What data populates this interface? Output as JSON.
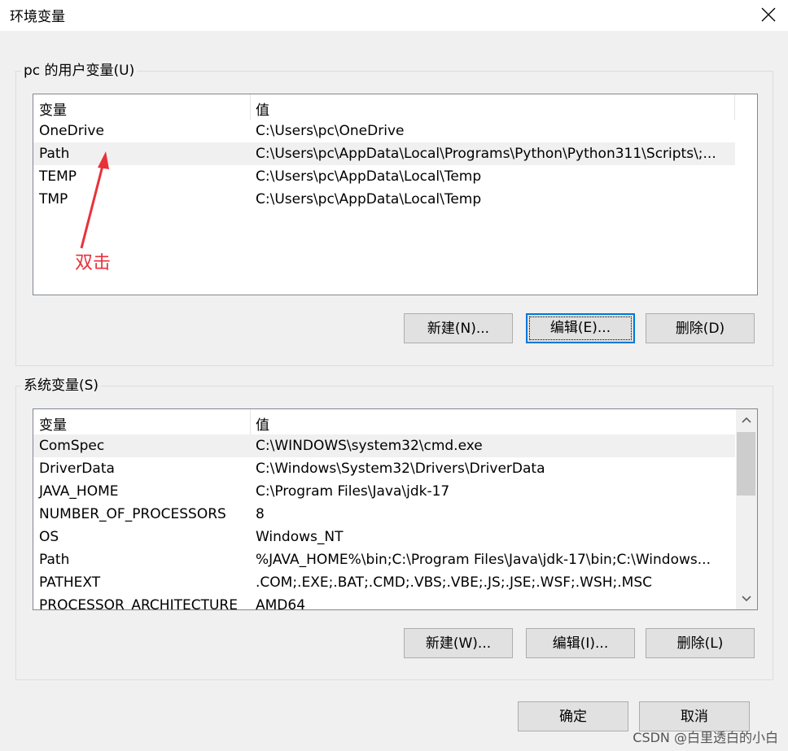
{
  "window": {
    "title": "环境变量"
  },
  "user_group": {
    "label": "pc 的用户变量(U)",
    "columns": [
      "变量",
      "值"
    ],
    "rows": [
      {
        "name": "OneDrive",
        "value": "C:\\Users\\pc\\OneDrive"
      },
      {
        "name": "Path",
        "value": "C:\\Users\\pc\\AppData\\Local\\Programs\\Python\\Python311\\Scripts\\;..."
      },
      {
        "name": "TEMP",
        "value": "C:\\Users\\pc\\AppData\\Local\\Temp"
      },
      {
        "name": "TMP",
        "value": "C:\\Users\\pc\\AppData\\Local\\Temp"
      }
    ],
    "buttons": {
      "new": "新建(N)...",
      "edit": "编辑(E)...",
      "delete": "删除(D)"
    }
  },
  "system_group": {
    "label": "系统变量(S)",
    "columns": [
      "变量",
      "值"
    ],
    "rows": [
      {
        "name": "ComSpec",
        "value": "C:\\WINDOWS\\system32\\cmd.exe"
      },
      {
        "name": "DriverData",
        "value": "C:\\Windows\\System32\\Drivers\\DriverData"
      },
      {
        "name": "JAVA_HOME",
        "value": "C:\\Program Files\\Java\\jdk-17"
      },
      {
        "name": "NUMBER_OF_PROCESSORS",
        "value": "8"
      },
      {
        "name": "OS",
        "value": "Windows_NT"
      },
      {
        "name": "Path",
        "value": "%JAVA_HOME%\\bin;C:\\Program Files\\Java\\jdk-17\\bin;C:\\Windows..."
      },
      {
        "name": "PATHEXT",
        "value": ".COM;.EXE;.BAT;.CMD;.VBS;.VBE;.JS;.JSE;.WSF;.WSH;.MSC"
      },
      {
        "name": "PROCESSOR_ARCHITECTURE",
        "value": "AMD64"
      }
    ],
    "buttons": {
      "new": "新建(W)...",
      "edit": "编辑(I)...",
      "delete": "删除(L)"
    }
  },
  "footer": {
    "ok": "确定",
    "cancel": "取消"
  },
  "annotation": {
    "text": "双击",
    "color": "#e8323a"
  },
  "watermark": "CSDN @白里透白的小白",
  "colors": {
    "focus": "#0078d7",
    "button_bg": "#e1e1e1",
    "dialog_bg": "#f0f0f0"
  }
}
